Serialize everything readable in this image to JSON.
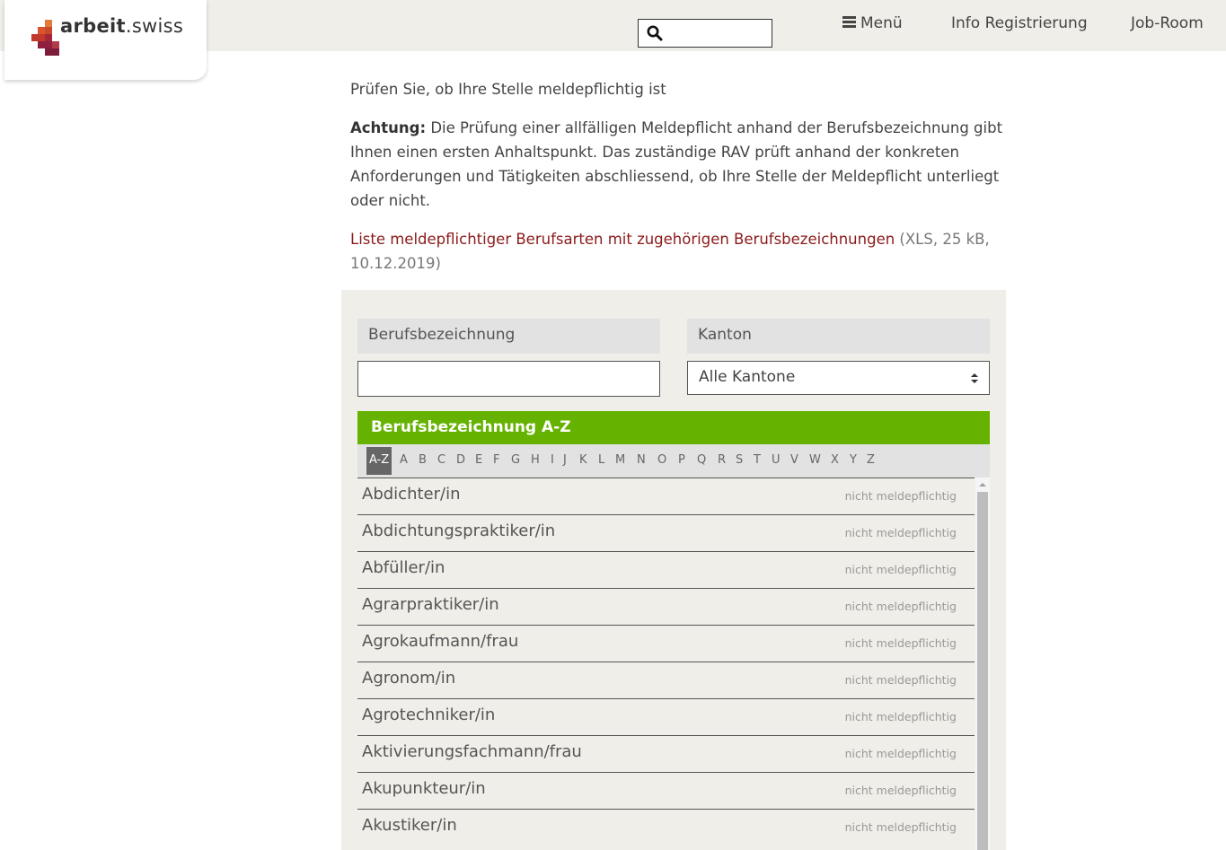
{
  "header": {
    "logo": {
      "brand": "arbeit",
      "suffix": ".swiss"
    },
    "search": {
      "placeholder": ""
    },
    "nav": {
      "menu_label": "Menü",
      "info_label": "Info Registrierung",
      "jobroom_label": "Job-Room"
    }
  },
  "content": {
    "intro": "Prüfen Sie, ob Ihre Stelle meldepflichtig ist",
    "notice_label": "Achtung:",
    "notice_text": " Die Prüfung einer allfälligen Meldepflicht anhand der Berufsbezeichnung gibt Ihnen einen ersten Anhaltspunkt. Das zuständige RAV prüft anhand der konkreten Anforderungen und Tätigkeiten abschliessend, ob Ihre Stelle der Meldepflicht unterliegt oder nicht.",
    "list_link": "Liste meldepflichtiger Berufsarten mit zugehörigen Berufsbezeichnungen",
    "list_meta": " (XLS, 25 kB, 10.12.2019)"
  },
  "filters": {
    "job_label": "Berufsbezeichnung",
    "job_value": "",
    "canton_label": "Kanton",
    "canton_selected": "Alle Kantone"
  },
  "az": {
    "header": "Berufsbezeichnung A-Z",
    "letters": [
      "A-Z",
      "A",
      "B",
      "C",
      "D",
      "E",
      "F",
      "G",
      "H",
      "I",
      "J",
      "K",
      "L",
      "M",
      "N",
      "O",
      "P",
      "Q",
      "R",
      "S",
      "T",
      "U",
      "V",
      "W",
      "X",
      "Y",
      "Z"
    ],
    "active": "A-Z"
  },
  "jobs": [
    {
      "name": "Abdichter/in",
      "status": "nicht meldepflichtig"
    },
    {
      "name": "Abdichtungspraktiker/in",
      "status": "nicht meldepflichtig"
    },
    {
      "name": "Abfüller/in",
      "status": "nicht meldepflichtig"
    },
    {
      "name": "Agrarpraktiker/in",
      "status": "nicht meldepflichtig"
    },
    {
      "name": "Agrokaufmann/frau",
      "status": "nicht meldepflichtig"
    },
    {
      "name": "Agronom/in",
      "status": "nicht meldepflichtig"
    },
    {
      "name": "Agrotechniker/in",
      "status": "nicht meldepflichtig"
    },
    {
      "name": "Aktivierungsfachmann/frau",
      "status": "nicht meldepflichtig"
    },
    {
      "name": "Akupunkteur/in",
      "status": "nicht meldepflichtig"
    },
    {
      "name": "Akustiker/in",
      "status": "nicht meldepflichtig"
    }
  ],
  "colors": {
    "accent_green": "#65b300",
    "link_red": "#8b1a1a",
    "header_bg": "#f0eee9"
  }
}
